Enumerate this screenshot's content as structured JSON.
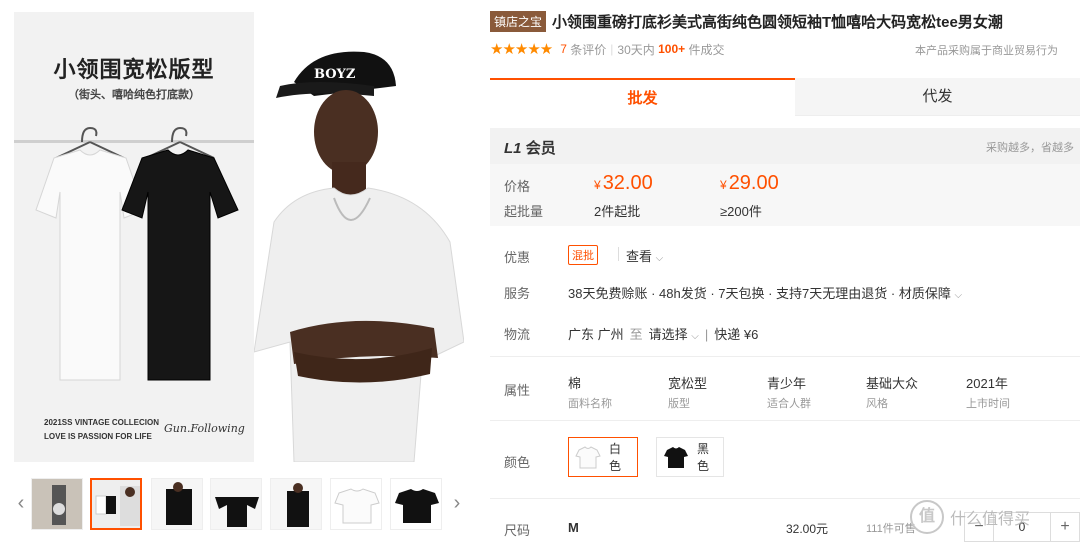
{
  "gallery": {
    "poster_title": "小领围宽松版型",
    "poster_subtitle": "（街头、嘻哈纯色打底款）",
    "poster_footer_line1": "2021SS VINTAGE COLLECION",
    "poster_footer_line2": "LOVE IS PASSION FOR LIFE",
    "poster_signature": "Gun.Following",
    "cap_text": "BOYZ",
    "thumbnails": [
      {
        "name": "lifestyle-photo"
      },
      {
        "name": "poster-photo"
      },
      {
        "name": "model-side-photo"
      },
      {
        "name": "model-back-photo"
      },
      {
        "name": "model-walking-photo"
      },
      {
        "name": "white-tee-photo"
      },
      {
        "name": "black-tee-photo"
      }
    ],
    "active_thumbnail": 1
  },
  "product": {
    "shop_tag": "镇店之宝",
    "title": "小领围重磅打底衫美式高街纯色圆领短袖T恤嘻哈大码宽松tee男女潮",
    "stars": "★★★★★",
    "review_count": "7",
    "review_label": "条评价",
    "deals_prefix": "30天内",
    "deals_count": "100+",
    "deals_label": "件成交",
    "notice": "本产品采购属于商业贸易行为"
  },
  "tabs": {
    "wholesale": "批发",
    "dropship": "代发"
  },
  "member": {
    "level": "L1",
    "label": "会员",
    "hint": "采购越多，省越多"
  },
  "pricing": {
    "price_label": "价格",
    "moq_label": "起批量",
    "currency": "¥",
    "tiers": [
      {
        "price": "32.00",
        "moq": "2件起批"
      },
      {
        "price": "29.00",
        "moq": "≥200件"
      }
    ]
  },
  "promo": {
    "label": "优惠",
    "tag": "混批",
    "view": "查看"
  },
  "service": {
    "label": "服务",
    "text": "38天免费赊账 · 48h发货 · 7天包换 · 支持7天无理由退货 · 材质保障"
  },
  "logistics": {
    "label": "物流",
    "from": "广东 广州",
    "to_word": "至",
    "select": "请选择",
    "express": "快递",
    "fee": "¥6"
  },
  "attributes": {
    "label": "属性",
    "items": [
      {
        "value": "棉",
        "key": "面料名称"
      },
      {
        "value": "宽松型",
        "key": "版型"
      },
      {
        "value": "青少年",
        "key": "适合人群"
      },
      {
        "value": "基础大众",
        "key": "风格"
      },
      {
        "value": "2021年",
        "key": "上市时间"
      }
    ]
  },
  "colors": {
    "label": "颜色",
    "options": [
      {
        "name": "白色",
        "swatch": "#f4f4f4"
      },
      {
        "name": "黑色",
        "swatch": "#111111"
      }
    ],
    "selected": 0
  },
  "size": {
    "label": "尺码",
    "value": "M",
    "price": "32.00元",
    "stock": "111件可售",
    "quantity": "0",
    "minus": "−",
    "plus": "+"
  },
  "watermark": {
    "logo": "值",
    "text": "什么值得买"
  },
  "theme": {
    "accent": "#ff5000",
    "star": "#ff8a00",
    "shop_tag_bg": "#8a5a3a"
  }
}
